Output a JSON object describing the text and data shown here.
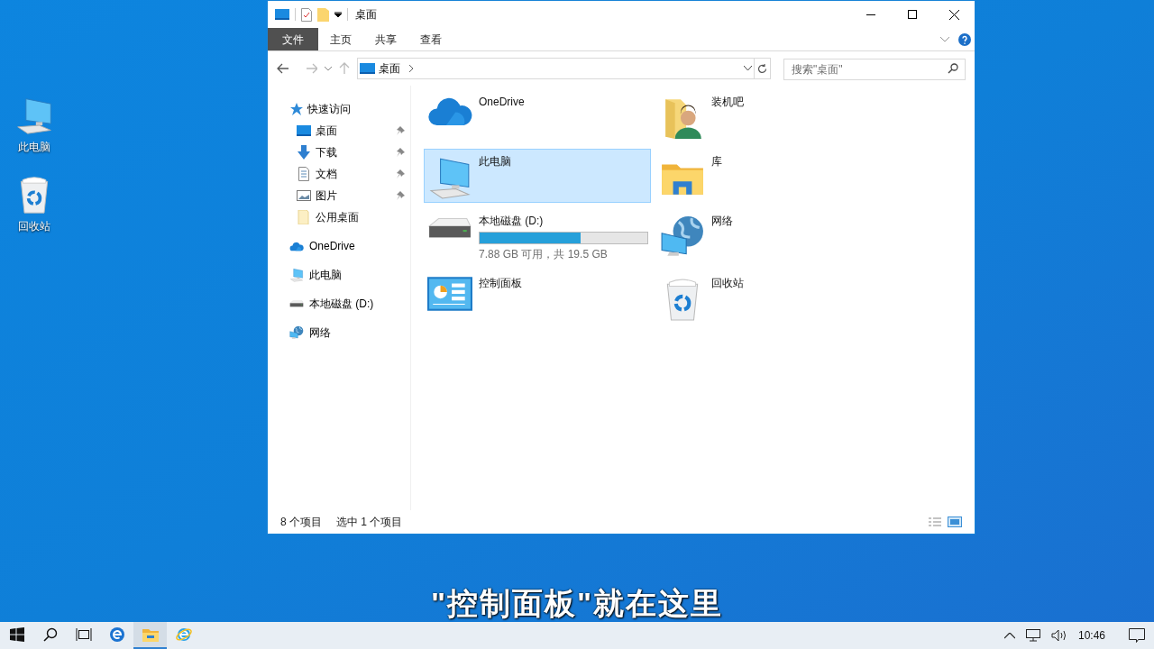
{
  "desktop_icons": [
    {
      "label": "此电脑",
      "kind": "pc"
    },
    {
      "label": "回收站",
      "kind": "bin"
    }
  ],
  "window": {
    "title": "桌面",
    "ribbon_tabs": [
      {
        "label": "文件",
        "selected": true
      },
      {
        "label": "主页",
        "selected": false
      },
      {
        "label": "共享",
        "selected": false
      },
      {
        "label": "查看",
        "selected": false
      }
    ],
    "address": {
      "path": "桌面"
    },
    "search": {
      "placeholder": "搜索\"桌面\""
    },
    "nav": [
      {
        "label": "快速访问",
        "kind": "star",
        "children": [
          {
            "label": "桌面",
            "kind": "desktop",
            "pinned": true
          },
          {
            "label": "下载",
            "kind": "download",
            "pinned": true
          },
          {
            "label": "文档",
            "kind": "doc",
            "pinned": true
          },
          {
            "label": "图片",
            "kind": "picture",
            "pinned": true
          },
          {
            "label": "公用桌面",
            "kind": "folder",
            "pinned": false
          }
        ]
      },
      {
        "label": "OneDrive",
        "kind": "cloud"
      },
      {
        "label": "此电脑",
        "kind": "pc"
      },
      {
        "label": "本地磁盘 (D:)",
        "kind": "drive"
      },
      {
        "label": "网络",
        "kind": "network"
      }
    ],
    "items": [
      {
        "label": "OneDrive",
        "kind": "cloud",
        "selected": false
      },
      {
        "label": "装机吧",
        "kind": "user",
        "selected": false
      },
      {
        "label": "此电脑",
        "kind": "pc",
        "selected": true
      },
      {
        "label": "库",
        "kind": "library",
        "selected": false
      },
      {
        "label": "本地磁盘 (D:)",
        "kind": "drive",
        "selected": false,
        "level": 0.6,
        "detail": "7.88 GB 可用，共 19.5 GB"
      },
      {
        "label": "网络",
        "kind": "network",
        "selected": false
      },
      {
        "label": "控制面板",
        "kind": "control",
        "selected": false
      },
      {
        "label": "回收站",
        "kind": "bin",
        "selected": false
      }
    ],
    "status_bar": {
      "count": "8 个项目",
      "selection": "选中 1 个项目"
    }
  },
  "subtitle": "\"控制面板\"就在这里",
  "taskbar": {
    "apps": [
      {
        "kind": "start",
        "selected": false
      },
      {
        "kind": "search",
        "selected": false
      },
      {
        "kind": "taskview",
        "selected": false
      },
      {
        "kind": "edge",
        "selected": false
      },
      {
        "kind": "explorer",
        "selected": true
      },
      {
        "kind": "ie",
        "selected": false
      }
    ],
    "time": "10:46"
  }
}
